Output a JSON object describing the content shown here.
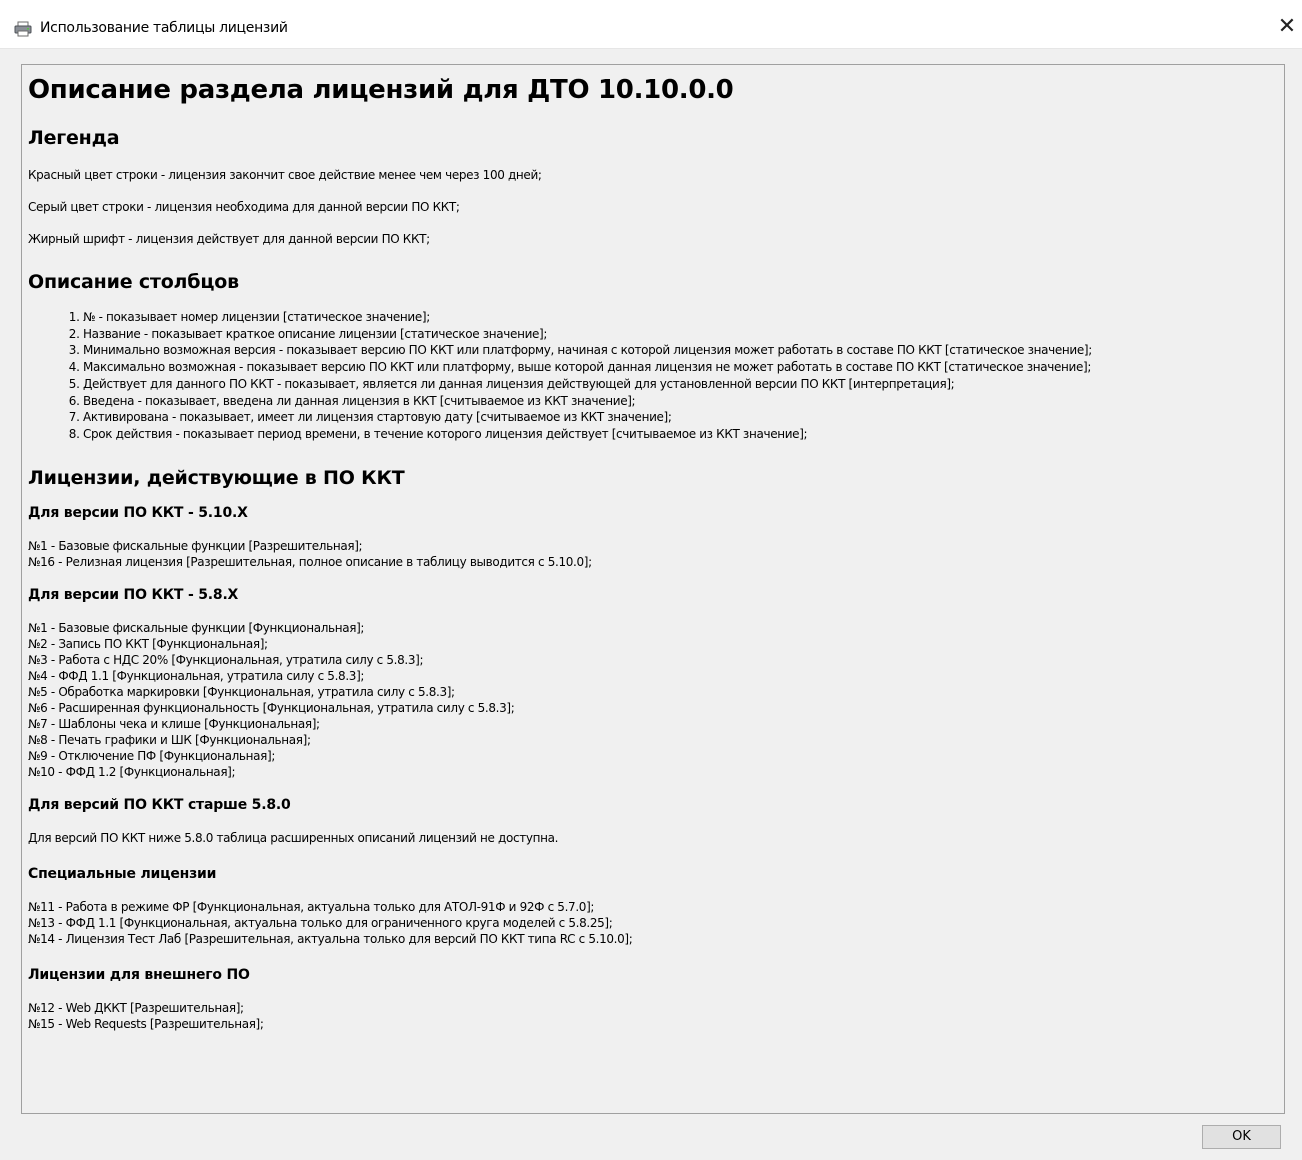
{
  "window": {
    "title": "Использование таблицы лицензий",
    "app_icon": "printer-icon",
    "close_glyph": "✕"
  },
  "doc": {
    "heading": "Описание раздела лицензий для ДТО 10.10.0.0",
    "legend": {
      "heading": "Легенда",
      "items": [
        "Красный цвет строки - лицензия закончит свое действие менее чем через 100 дней;",
        "Серый цвет строки - лицензия необходима для данной версии ПО ККТ;",
        "Жирный шрифт - лицензия действует для данной версии ПО ККТ;"
      ]
    },
    "columns": {
      "heading": "Описание столбцов",
      "items": [
        "№  - показывает номер лицензии [статическое значение];",
        "Название - показывает краткое описание лицензии [статическое значение];",
        "Минимально возможная версия - показывает версию ПО ККТ или платформу, начиная с которой лицензия может работать в составе ПО ККТ [статическое значение];",
        "Максимально возможная - показывает версию ПО ККТ или платформу, выше которой данная лицензия не может работать в составе ПО ККТ [статическое значение];",
        "Действует для данного ПО ККТ - показывает, является ли данная лицензия действующей для установленной версии ПО ККТ [интерпретация];",
        "Введена - показывает, введена ли данная лицензия в ККТ [считываемое из ККТ значение];",
        "Активирована - показывает, имеет ли лицензия стартовую дату [считываемое из ККТ значение];",
        "Срок действия - показывает период времени, в течение которого лицензия действует [считываемое из ККТ значение];"
      ]
    },
    "licenses": {
      "heading": "Лицензии, действующие в ПО ККТ",
      "v510": {
        "heading": "Для версии ПО ККТ - 5.10.X",
        "items": [
          "№1 - Базовые фискальные функции [Разрешительная];",
          "№16 - Релизная лицензия [Разрешительная, полное описание в таблицу выводится с 5.10.0];"
        ]
      },
      "v58": {
        "heading": "Для версии ПО ККТ - 5.8.X",
        "items": [
          "№1 - Базовые фискальные функции [Функциональная];",
          "№2 - Запись ПО ККТ [Функциональная];",
          "№3 - Работа с НДС 20% [Функциональная, утратила силу с 5.8.3];",
          "№4 - ФФД 1.1 [Функциональная, утратила силу с 5.8.3];",
          "№5 - Обработка маркировки [Функциональная, утратила силу с 5.8.3];",
          "№6 - Расширенная функциональность [Функциональная, утратила силу с 5.8.3];",
          "№7 - Шаблоны чека и клише [Функциональная];",
          "№8 - Печать графики и ШК [Функциональная];",
          "№9 - Отключение ПФ [Функциональная];",
          "№10 - ФФД 1.2 [Функциональная];"
        ]
      },
      "older": {
        "heading": "Для версий ПО ККТ старше 5.8.0",
        "text": "Для версий ПО ККТ ниже 5.8.0 таблица расширенных описаний лицензий не доступна."
      },
      "special": {
        "heading": "Специальные лицензии",
        "items": [
          "№11 - Работа в режиме ФР [Функциональная, актуальна только для АТОЛ-91Ф и 92Ф с 5.7.0];",
          "№13 - ФФД 1.1 [Функциональная, актуальна только для ограниченного круга моделей с 5.8.25];",
          "№14 - Лицензия Тест Лаб [Разрешительная, актуальна только для версий ПО ККТ типа RC с 5.10.0];"
        ]
      },
      "external": {
        "heading": "Лицензии для внешнего ПО",
        "items": [
          "№12 - Web ДККТ [Разрешительная];",
          "№15 - Web Requests [Разрешительная];"
        ]
      }
    }
  },
  "footer": {
    "ok_label": "OK"
  }
}
